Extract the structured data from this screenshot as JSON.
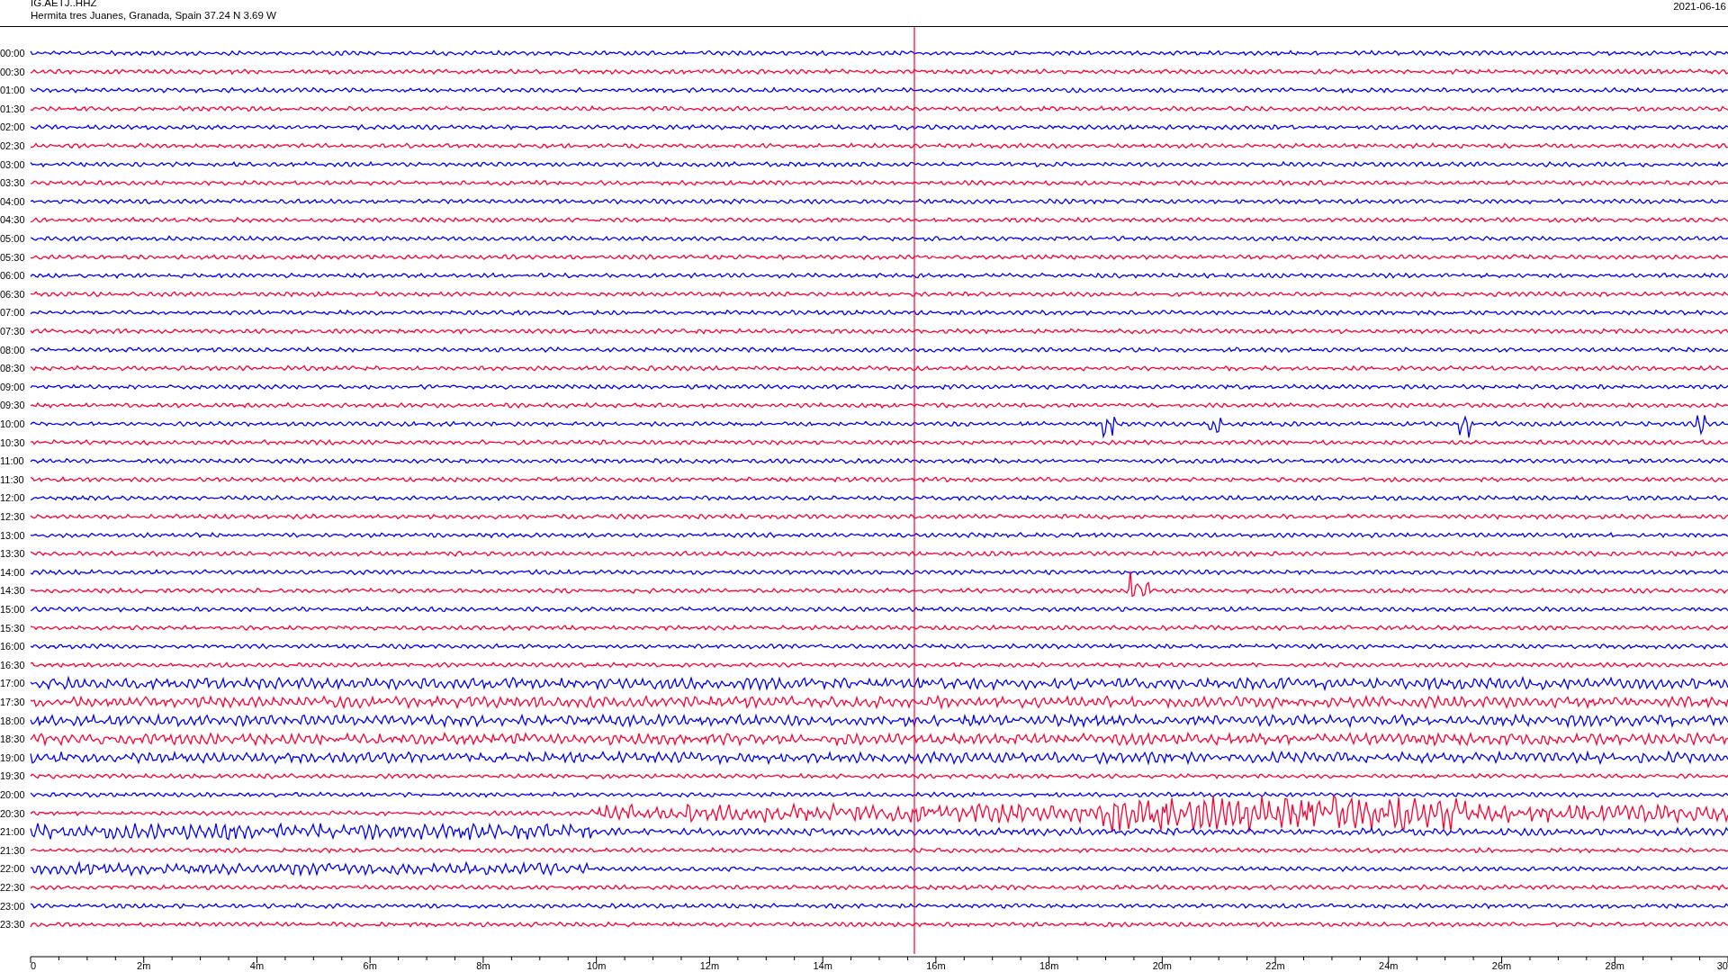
{
  "header": {
    "station": "IG.AETJ..HHZ",
    "location": "Hermita tres Juanes, Granada, Spain  37.24 N 3.69 W",
    "date": "2021-06-16"
  },
  "rows": [
    {
      "label": "00:00",
      "color": "#0000ff"
    },
    {
      "label": "00:30",
      "color": "#ff0033"
    },
    {
      "label": "01:00",
      "color": "#0000ff"
    },
    {
      "label": "01:30",
      "color": "#ff0033"
    },
    {
      "label": "02:00",
      "color": "#0000ff"
    },
    {
      "label": "02:30",
      "color": "#ff0033"
    },
    {
      "label": "03:00",
      "color": "#0000ff"
    },
    {
      "label": "03:30",
      "color": "#ff0033"
    },
    {
      "label": "04:00",
      "color": "#0000ff"
    },
    {
      "label": "04:30",
      "color": "#ff0033"
    },
    {
      "label": "05:00",
      "color": "#0000ff"
    },
    {
      "label": "05:30",
      "color": "#ff0033"
    },
    {
      "label": "06:00",
      "color": "#0000ff"
    },
    {
      "label": "06:30",
      "color": "#ff0033"
    },
    {
      "label": "07:00",
      "color": "#0000ff"
    },
    {
      "label": "07:30",
      "color": "#ff0033"
    },
    {
      "label": "08:00",
      "color": "#0000ff"
    },
    {
      "label": "08:30",
      "color": "#ff0033"
    },
    {
      "label": "09:00",
      "color": "#0000ff"
    },
    {
      "label": "09:30",
      "color": "#ff0033"
    },
    {
      "label": "10:00",
      "color": "#0000ff"
    },
    {
      "label": "10:30",
      "color": "#ff0033"
    },
    {
      "label": "11:00",
      "color": "#0000ff"
    },
    {
      "label": "11:30",
      "color": "#ff0033"
    },
    {
      "label": "12:00",
      "color": "#0000ff"
    },
    {
      "label": "12:30",
      "color": "#ff0033"
    },
    {
      "label": "13:00",
      "color": "#0000ff"
    },
    {
      "label": "13:30",
      "color": "#ff0033"
    },
    {
      "label": "14:00",
      "color": "#0000ff"
    },
    {
      "label": "14:30",
      "color": "#ff0033"
    },
    {
      "label": "15:00",
      "color": "#0000ff"
    },
    {
      "label": "15:30",
      "color": "#ff0033"
    },
    {
      "label": "16:00",
      "color": "#0000ff"
    },
    {
      "label": "16:30",
      "color": "#ff0033"
    },
    {
      "label": "17:00",
      "color": "#0000ff"
    },
    {
      "label": "17:30",
      "color": "#ff0033"
    },
    {
      "label": "18:00",
      "color": "#0000ff"
    },
    {
      "label": "18:30",
      "color": "#ff0033"
    },
    {
      "label": "19:00",
      "color": "#0000ff"
    },
    {
      "label": "19:30",
      "color": "#ff0033"
    },
    {
      "label": "20:00",
      "color": "#0000ff"
    },
    {
      "label": "20:30",
      "color": "#ff0033"
    },
    {
      "label": "21:00",
      "color": "#0000ff"
    },
    {
      "label": "21:30",
      "color": "#ff0033"
    },
    {
      "label": "22:00",
      "color": "#0000ff"
    },
    {
      "label": "22:30",
      "color": "#ff0033"
    },
    {
      "label": "23:00",
      "color": "#0000ff"
    },
    {
      "label": "23:30",
      "color": "#ff0033"
    }
  ],
  "x_axis": {
    "labels": [
      "0",
      "2m",
      "4m",
      "6m",
      "8m",
      "10m",
      "12m",
      "14m",
      "16m",
      "18m",
      "20m",
      "22m",
      "24m",
      "26m",
      "28m",
      "30"
    ]
  }
}
